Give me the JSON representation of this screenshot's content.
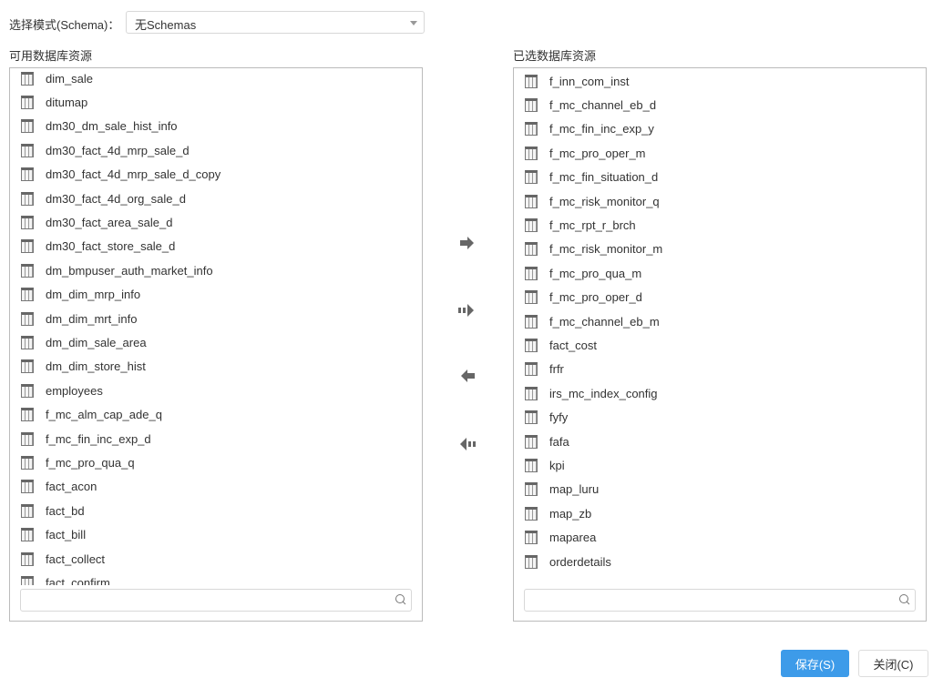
{
  "schema": {
    "label": "选择模式(Schema)：",
    "value": "无Schemas"
  },
  "available": {
    "title": "可用数据库资源",
    "items": [
      "dim_sale",
      "ditumap",
      "dm30_dm_sale_hist_info",
      "dm30_fact_4d_mrp_sale_d",
      "dm30_fact_4d_mrp_sale_d_copy",
      "dm30_fact_4d_org_sale_d",
      "dm30_fact_area_sale_d",
      "dm30_fact_store_sale_d",
      "dm_bmpuser_auth_market_info",
      "dm_dim_mrp_info",
      "dm_dim_mrt_info",
      "dm_dim_sale_area",
      "dm_dim_store_hist",
      "employees",
      "f_mc_alm_cap_ade_q",
      "f_mc_fin_inc_exp_d",
      "f_mc_pro_qua_q",
      "fact_acon",
      "fact_bd",
      "fact_bill",
      "fact_collect",
      "fact_confirm"
    ],
    "search_value": ""
  },
  "selected": {
    "title": "已选数据库资源",
    "items": [
      "f_inn_com_inst",
      "f_mc_channel_eb_d",
      "f_mc_fin_inc_exp_y",
      "f_mc_pro_oper_m",
      "f_mc_fin_situation_d",
      "f_mc_risk_monitor_q",
      "f_mc_rpt_r_brch",
      "f_mc_risk_monitor_m",
      "f_mc_pro_qua_m",
      "f_mc_pro_oper_d",
      "f_mc_channel_eb_m",
      "fact_cost",
      "frfr",
      "irs_mc_index_config",
      "fyfy",
      "fafa",
      "kpi",
      "map_luru",
      "map_zb",
      "maparea",
      "orderdetails"
    ],
    "search_value": ""
  },
  "buttons": {
    "save": "保存(S)",
    "close": "关闭(C)"
  },
  "colors": {
    "primary": "#3d9be9"
  }
}
